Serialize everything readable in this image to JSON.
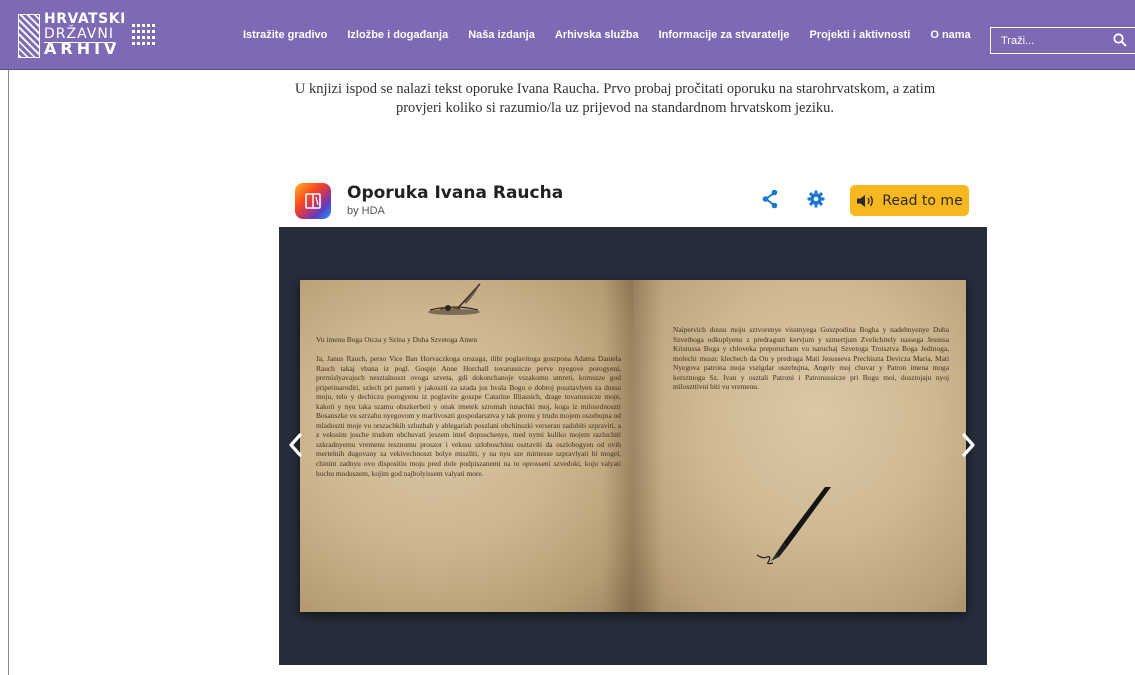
{
  "header": {
    "logo": {
      "line1": "HRVATSKI",
      "line2": "DRŽAVNI",
      "line3": "ARHIV"
    },
    "nav": [
      {
        "label": "Istražite gradivo"
      },
      {
        "label": "Izložbe i događanja"
      },
      {
        "label": "Naša izdanja"
      },
      {
        "label": "Arhivska služba"
      },
      {
        "label": "Informacije za stvaratelje"
      },
      {
        "label": "Projekti i aktivnosti"
      },
      {
        "label": "O nama"
      }
    ],
    "search": {
      "placeholder": "Traži..."
    }
  },
  "intro": {
    "line1": "U knjizi ispod se nalazi tekst oporuke Ivana Raucha. Prvo probaj pročitati oporuku na starohrvatskom, a zatim",
    "line2": "provjeri koliko si razumio/la uz prijevod na standardnom hrvatskom jeziku."
  },
  "book": {
    "title": "Oporuka Ivana Raucha",
    "author": "by HDA",
    "read_label": "Read to me",
    "left_heading": "Vu imenu Boga Otcza y Szina y Duha Szvetoga Amen",
    "left_body": "Ja, Janus Rauch, perso Vice Ban Horvaczkoga orszaga, ilibi poglavitoga goszpona Adama Daniela Rauch takaj vbana iz pogl. Gospje Anne Horchall tovarussicze perve nyegove porogyeni, premislyavajuch nesztalnoszt ovoga szveta, gdi dokonchanoje vszakomu umreti, komusze god pripetinaroditi, szlech pri pameti y jakoszti za szada jos hvala Bogu o dobroj posztavlyen za dussu moju, telo y dechiczu porogyenu iz poglavite goszpe Catarine Illiassich, drage tovarussicze moje, kakoti y nyu taka szamu obszkerbeti y onak imetek szromah iunachki moj, koga iz milosrdnoszti Bosanszke vu szrzahu nyegovom y marlivoszti gospodarsztva y tak pronu y trudu mojem oszebujna od mladoszti moje vu orszachkih szluzbah y ablegariah poszlani obchinszki verseran zadobiti szpraviti, a z vekssim josche trudom obchuvati jeszem imel dopuschenye, med nymi kuliko mojem razluchiti szkradnyemu vremenu tesznomu proszor i vekssu szloboschinu osztaviti da oszlobogyen od ovih mertelnih dugovany za vekivechnoszt bolye miszliti, y na nyu sze mirnesse szpravlyati bi mogel, chinim zadnyu ovu dispositiu moju pred dole podpiszanemi na to oprosseni szvedoki, koju valyati hochu moduszem, kojim god najbolyissem valyati more.",
    "right_body": "Naipervich dussu moju sztvorenye visstnyega Goszpodina Bogha y nadehnyenye Duha Szvethoga odkuplyenu z predragum kervjum y szmertjum Zvelichitely nassega Jesussa Kristussa Boga y chloveka preporucham vu naruchaj Szvetoga Troisztva Boga Jedinoga, molechi muszc klechech da On y predraga Mati Jesusseva Prechiszta Devicza Maria, Mati Nyegova patrona moja vszigdar oszebujna, Angely moj chuvar y Patron imena moga kersztnoga Sz. Ivan y osztali Patroni i Patronussicze pri Bogu moi, dosztojaju nyoj miloszttivni biti vu vremenu."
  },
  "colors": {
    "nav_bg": "#7d69b4",
    "accent_blue": "#1976d2",
    "read_button": "#f7b81f",
    "stage_bg": "#262d3b"
  },
  "icons": {
    "grid": "grid-icon",
    "search": "search-icon",
    "share": "share-icon",
    "settings": "gear-icon",
    "speaker": "speaker-icon",
    "prev": "chevron-left-icon",
    "next": "chevron-right-icon"
  }
}
